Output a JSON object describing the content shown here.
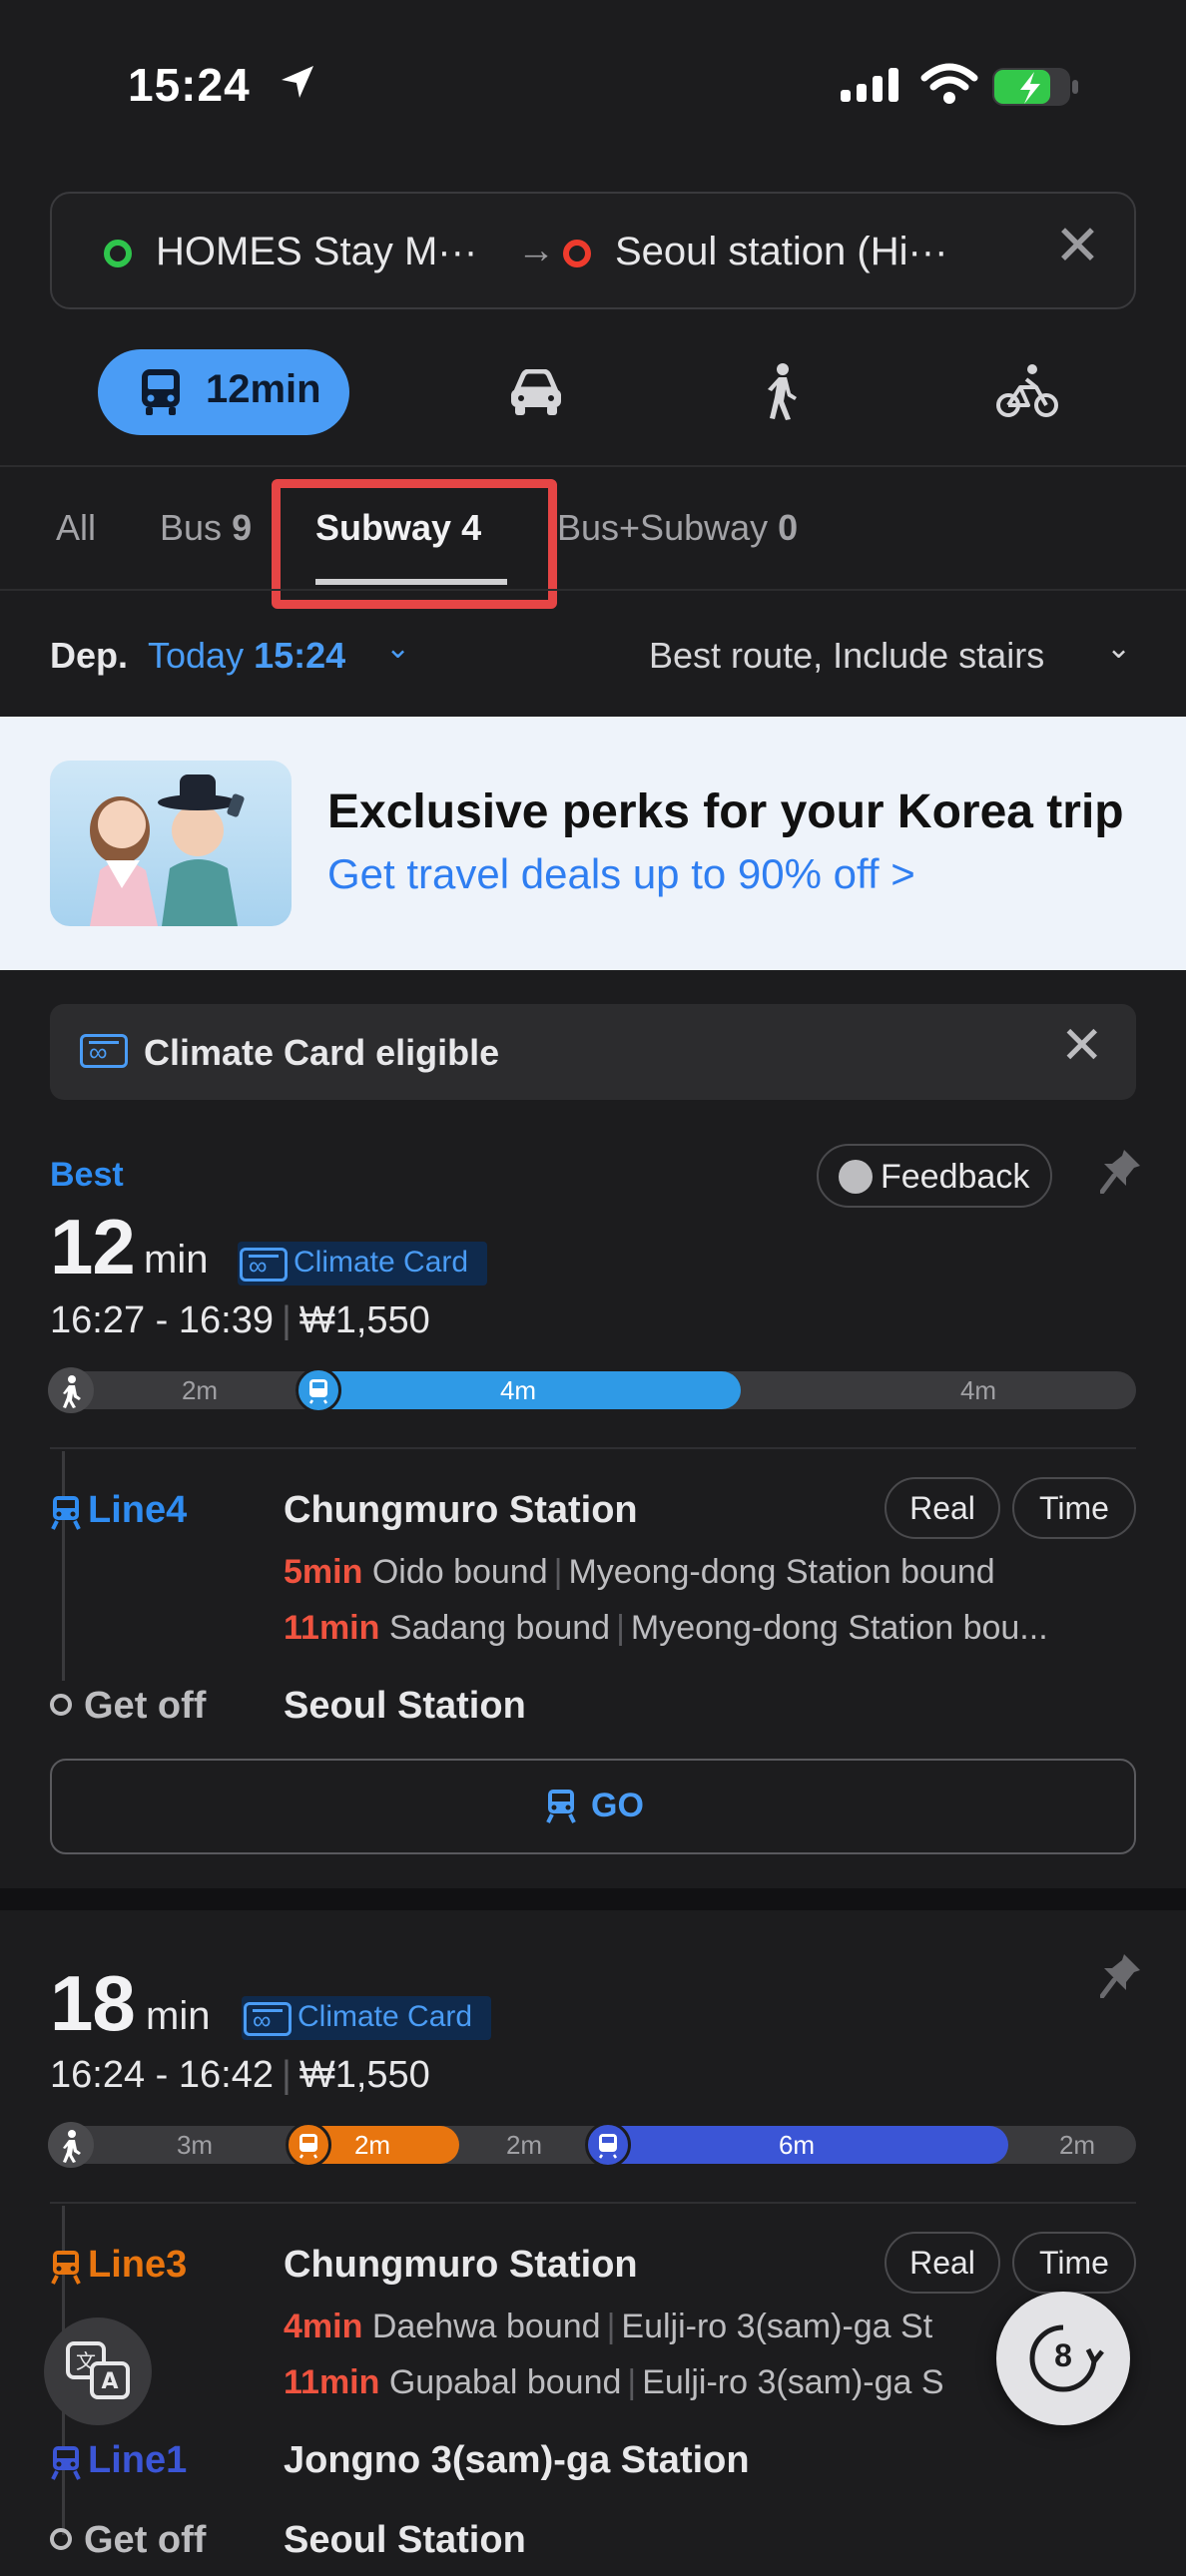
{
  "status_bar": {
    "time": "15:24"
  },
  "route": {
    "origin": "HOMES Stay M···",
    "destination": "Seoul station (Hi···",
    "arrow": "→"
  },
  "modes": {
    "transit_label": "12min"
  },
  "categories": {
    "all": "All",
    "bus": "Bus",
    "bus_count": "9",
    "subway": "Subway",
    "subway_count": "4",
    "bus_subway": "Bus+Subway",
    "bus_subway_count": "0"
  },
  "departure": {
    "label": "Dep.",
    "day": "Today",
    "time": "15:24",
    "route_pref": "Best route, Include stairs"
  },
  "banner": {
    "title": "Exclusive perks for your Korea trip",
    "subtitle": "Get travel deals up to 90% off >"
  },
  "climate_notice": {
    "text": "Climate Card eligible"
  },
  "routes": [
    {
      "badge": "Best",
      "feedback": "Feedback",
      "duration_num": "12",
      "duration_unit": "min",
      "climate_card": "Climate Card",
      "times": "16:27 - 16:39",
      "fare": "₩1,550",
      "bar": {
        "walk1": "2m",
        "ride1": "4m",
        "walk2": "4m"
      },
      "legs": [
        {
          "line": "Line4",
          "color": "#2f8cf1",
          "station": "Chungmuro Station",
          "real": "Real",
          "time": "Time",
          "arrivals": [
            {
              "mins": "5min",
              "dir": "Oido bound",
              "next": "Myeong-dong Station bound"
            },
            {
              "mins": "11min",
              "dir": "Sadang bound",
              "next": "Myeong-dong Station bou..."
            }
          ]
        }
      ],
      "getoff_label": "Get off",
      "getoff_station": "Seoul Station",
      "go": "GO"
    },
    {
      "duration_num": "18",
      "duration_unit": "min",
      "climate_card": "Climate Card",
      "times": "16:24 - 16:42",
      "fare": "₩1,550",
      "bar": {
        "walk1": "3m",
        "ride1": "2m",
        "walk2": "2m",
        "ride2": "6m",
        "walk3": "2m"
      },
      "legs": [
        {
          "line": "Line3",
          "color": "#e8750f",
          "station": "Chungmuro Station",
          "real": "Real",
          "time": "Time",
          "arrivals": [
            {
              "mins": "4min",
              "dir": "Daehwa bound",
              "next": "Eulji-ro 3(sam)-ga St"
            },
            {
              "mins": "11min",
              "dir": "Gupabal bound",
              "next": "Eulji-ro 3(sam)-ga S"
            }
          ]
        },
        {
          "line": "Line1",
          "color": "#3b55d6",
          "station": "Jongno 3(sam)-ga Station"
        }
      ],
      "getoff_label": "Get off",
      "getoff_station": "Seoul Station"
    }
  ],
  "floating": {
    "refresh_count": "8"
  }
}
